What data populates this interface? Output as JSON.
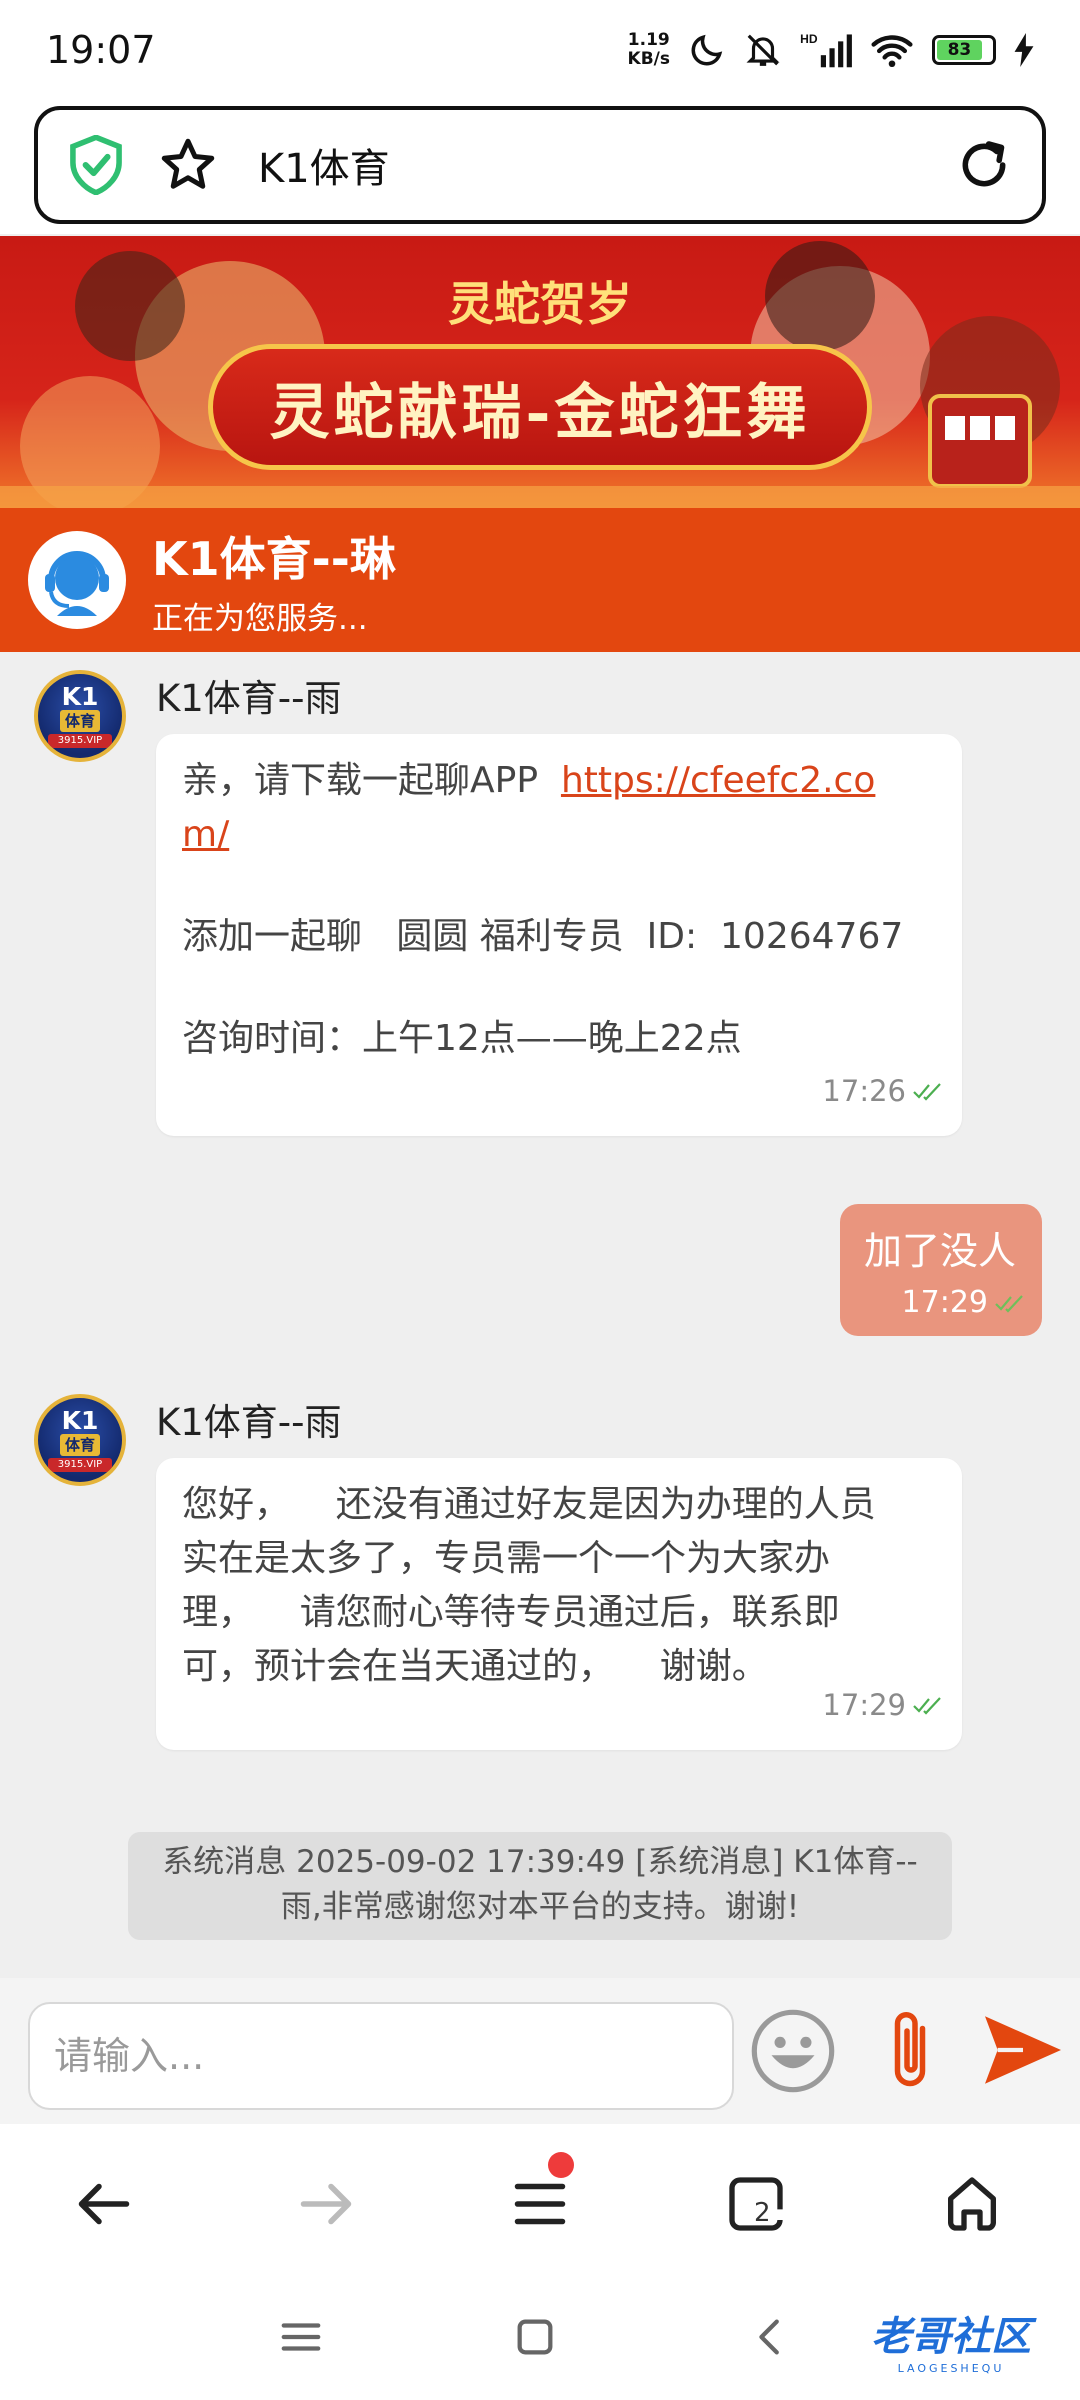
{
  "status_bar": {
    "time": "19:07",
    "net_speed_value": "1.19",
    "net_speed_unit": "KB/s",
    "battery": "83",
    "icons": [
      "moon-icon",
      "silent-icon",
      "signal-icon",
      "wifi-icon",
      "battery-icon",
      "charging-icon"
    ]
  },
  "browser": {
    "url_title": "K1体育"
  },
  "banner": {
    "subtitle": "灵蛇贺岁",
    "title": "灵蛇献瑞-金蛇狂舞"
  },
  "chat_header": {
    "title": "K1体育--琳",
    "status": "正在为您服务..."
  },
  "messages": [
    {
      "sender": "K1体育--雨",
      "line1_prefix": "亲，请下载一起聊APP",
      "link": "https://cfeefc2.com/",
      "link_part1": "https://cfeefc2.co",
      "link_part2": "m/",
      "line2": "添加一起聊   圆圆 福利专员  ID:  10264767",
      "line3": "咨询时间：上午12点——晚上22点",
      "time": "17:26"
    },
    {
      "text": "加了没人",
      "time": "17:29"
    },
    {
      "sender": "K1体育--雨",
      "line1": "您好，    还没有通过好友是因为办理的人员",
      "line2": "实在是太多了，专员需一个一个为大家办",
      "line3": "理，    请您耐心等待专员通过后，联系即",
      "line4": "可，预计会在当天通过的，    谢谢。",
      "time": "17:29"
    }
  ],
  "avatar_badge": {
    "k1": "K1",
    "ty": "体育",
    "vip": "3915.VIP"
  },
  "system_message": {
    "line1": "系统消息 2025-09-02 17:39:49 [系统消息] K1体育--",
    "line2": "雨,非常感谢您对本平台的支持。谢谢!"
  },
  "input": {
    "placeholder": "请输入..."
  },
  "browser_nav": {
    "tab_count": "2"
  },
  "watermark": {
    "text": "老哥社区",
    "sub": "LAOGESHEQU"
  },
  "colors": {
    "accent": "#e3470f",
    "outgoing_bubble": "#e9957e",
    "link": "#d9441a",
    "shield": "#2fbf71"
  }
}
